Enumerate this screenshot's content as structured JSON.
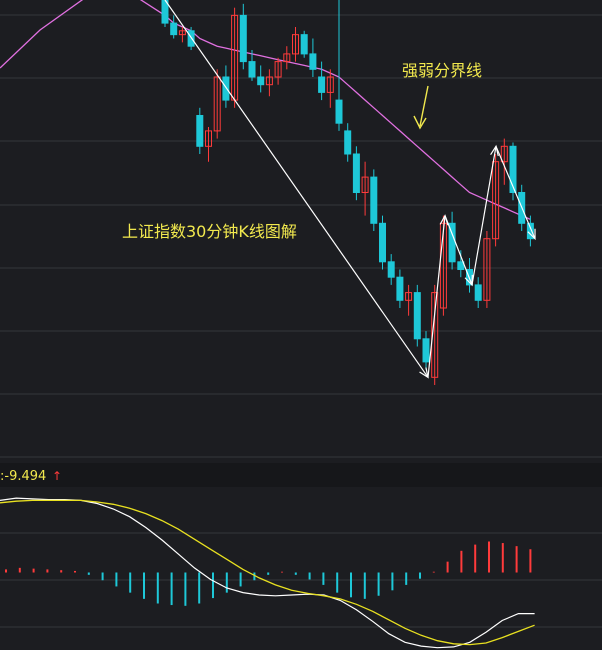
{
  "annotations": {
    "main_label": "上证指数30分钟K线图解",
    "boundary_label": "强弱分界线"
  },
  "macd_readout": {
    "prefix": ":-9.494",
    "arrow": "↑"
  },
  "colors": {
    "background": "#1c1d21",
    "grid": "#34363c",
    "up": "#ff3b3b",
    "down": "#1ec8d8",
    "ma_line": "#e070e0",
    "annotation_text": "#f2e94e",
    "arrows": "#ffffff",
    "dif": "#ffffff",
    "dea": "#e8e020"
  },
  "chart_data": {
    "type": "candlestick",
    "price_ylim": [
      0,
      100
    ],
    "candles": [
      {
        "o": 100,
        "h": 100,
        "l": 93,
        "c": 94
      },
      {
        "o": 94,
        "h": 96,
        "l": 90,
        "c": 91
      },
      {
        "o": 91,
        "h": 93,
        "l": 89,
        "c": 92
      },
      {
        "o": 92,
        "h": 93,
        "l": 87,
        "c": 88
      },
      {
        "o": 70,
        "h": 72,
        "l": 60,
        "c": 62
      },
      {
        "o": 62,
        "h": 67,
        "l": 58,
        "c": 66
      },
      {
        "o": 66,
        "h": 82,
        "l": 64,
        "c": 80
      },
      {
        "o": 80,
        "h": 83,
        "l": 72,
        "c": 74
      },
      {
        "o": 74,
        "h": 98,
        "l": 72,
        "c": 96
      },
      {
        "o": 96,
        "h": 99,
        "l": 82,
        "c": 84
      },
      {
        "o": 84,
        "h": 87,
        "l": 79,
        "c": 80
      },
      {
        "o": 80,
        "h": 83,
        "l": 76,
        "c": 78
      },
      {
        "o": 78,
        "h": 82,
        "l": 75,
        "c": 80
      },
      {
        "o": 80,
        "h": 85,
        "l": 78,
        "c": 84
      },
      {
        "o": 84,
        "h": 88,
        "l": 82,
        "c": 86
      },
      {
        "o": 86,
        "h": 93,
        "l": 84,
        "c": 91
      },
      {
        "o": 91,
        "h": 92,
        "l": 85,
        "c": 86
      },
      {
        "o": 86,
        "h": 90,
        "l": 80,
        "c": 82
      },
      {
        "o": 80,
        "h": 84,
        "l": 74,
        "c": 76
      },
      {
        "o": 76,
        "h": 82,
        "l": 72,
        "c": 80
      },
      {
        "o": 74,
        "h": 100,
        "l": 66,
        "c": 68
      },
      {
        "o": 66,
        "h": 68,
        "l": 58,
        "c": 60
      },
      {
        "o": 60,
        "h": 62,
        "l": 48,
        "c": 50
      },
      {
        "o": 50,
        "h": 58,
        "l": 44,
        "c": 54
      },
      {
        "o": 54,
        "h": 56,
        "l": 40,
        "c": 42
      },
      {
        "o": 42,
        "h": 44,
        "l": 30,
        "c": 32
      },
      {
        "o": 32,
        "h": 34,
        "l": 26,
        "c": 28
      },
      {
        "o": 28,
        "h": 30,
        "l": 20,
        "c": 22
      },
      {
        "o": 22,
        "h": 26,
        "l": 18,
        "c": 24
      },
      {
        "o": 24,
        "h": 26,
        "l": 10,
        "c": 12
      },
      {
        "o": 12,
        "h": 14,
        "l": 4,
        "c": 6
      },
      {
        "o": 2,
        "h": 26,
        "l": 0,
        "c": 24
      },
      {
        "o": 20,
        "h": 44,
        "l": 18,
        "c": 42
      },
      {
        "o": 42,
        "h": 45,
        "l": 30,
        "c": 32
      },
      {
        "o": 32,
        "h": 35,
        "l": 28,
        "c": 30
      },
      {
        "o": 30,
        "h": 33,
        "l": 24,
        "c": 26
      },
      {
        "o": 26,
        "h": 28,
        "l": 20,
        "c": 22
      },
      {
        "o": 22,
        "h": 40,
        "l": 20,
        "c": 38
      },
      {
        "o": 38,
        "h": 60,
        "l": 36,
        "c": 58
      },
      {
        "o": 58,
        "h": 64,
        "l": 52,
        "c": 62
      },
      {
        "o": 62,
        "h": 63,
        "l": 48,
        "c": 50
      },
      {
        "o": 50,
        "h": 52,
        "l": 40,
        "c": 42
      },
      {
        "o": 42,
        "h": 44,
        "l": 36,
        "c": 38
      }
    ],
    "ma_line": [
      96,
      94,
      93,
      92,
      90,
      89,
      88,
      87.5,
      87,
      86.5,
      86,
      85.5,
      85,
      84.5,
      84,
      83.5,
      83,
      82.5,
      82,
      81,
      80,
      78,
      76,
      74,
      72,
      70,
      68,
      66,
      64,
      62,
      60,
      58,
      56,
      54,
      52,
      50,
      49,
      48,
      47,
      46,
      45,
      44,
      43
    ],
    "arrow_path_values": [
      100,
      2,
      44,
      26,
      62,
      38
    ],
    "macd": {
      "ylim": [
        -10,
        10
      ],
      "dif": [
        9.3,
        9.6,
        9.5,
        9.4,
        9.4,
        9.3,
        8.9,
        8.2,
        7.2,
        5.8,
        4.2,
        2.4,
        0.6,
        -0.9,
        -2.0,
        -2.6,
        -2.9,
        -3.0,
        -2.9,
        -2.8,
        -2.9,
        -3.6,
        -4.8,
        -6.3,
        -7.9,
        -9.0,
        -9.5,
        -9.7,
        -9.6,
        -9.0,
        -7.7,
        -6.2,
        -5.3,
        -5.3
      ],
      "dea": [
        9.0,
        9.2,
        9.3,
        9.3,
        9.3,
        9.3,
        9.1,
        8.8,
        8.3,
        7.6,
        6.7,
        5.6,
        4.3,
        3.0,
        1.7,
        0.4,
        -0.7,
        -1.6,
        -2.3,
        -2.7,
        -3.0,
        -3.4,
        -4.1,
        -5.0,
        -6.1,
        -7.2,
        -8.1,
        -8.8,
        -9.2,
        -9.3,
        -9.1,
        -8.4,
        -7.6,
        -6.8
      ],
      "histogram": [
        0.4,
        0.6,
        0.5,
        0.4,
        0.3,
        0.2,
        -0.3,
        -1.0,
        -1.8,
        -2.6,
        -3.4,
        -4.0,
        -4.2,
        -4.3,
        -4.0,
        -3.3,
        -2.6,
        -1.8,
        -1.0,
        -0.3,
        0.1,
        -0.3,
        -0.9,
        -1.6,
        -2.6,
        -3.2,
        -3.4,
        -3.0,
        -2.3,
        -1.6,
        -0.8,
        0.1,
        1.4,
        2.8,
        3.6,
        4.0,
        3.8,
        3.4,
        3.0
      ]
    }
  }
}
